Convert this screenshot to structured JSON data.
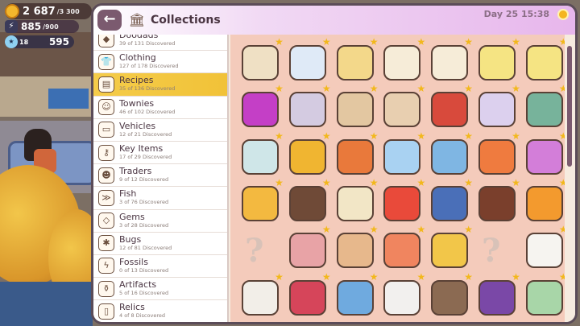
{
  "hud": {
    "coins": "2 687",
    "coins_max": "/3 300",
    "energy": "885",
    "energy_max": "/900",
    "level": "18",
    "points": "595"
  },
  "header": {
    "title": "Collections",
    "day": "Day 25",
    "time": "15:38"
  },
  "categories": [
    {
      "name": "Doodads",
      "sub": "39 of 131 Discovered",
      "icon": "doodads-icon",
      "glyph": "◆"
    },
    {
      "name": "Clothing",
      "sub": "127 of 178 Discovered",
      "icon": "shirt-icon",
      "glyph": "👕"
    },
    {
      "name": "Recipes",
      "sub": "35 of 136 Discovered",
      "icon": "recipes-icon",
      "glyph": "▤",
      "active": true
    },
    {
      "name": "Townies",
      "sub": "46 of 102 Discovered",
      "icon": "townies-icon",
      "glyph": "☺"
    },
    {
      "name": "Vehicles",
      "sub": "12 of 21 Discovered",
      "icon": "car-icon",
      "glyph": "▭"
    },
    {
      "name": "Key Items",
      "sub": "17 of 29 Discovered",
      "icon": "key-icon",
      "glyph": "⚷"
    },
    {
      "name": "Traders",
      "sub": "9 of 12 Discovered",
      "icon": "trader-icon",
      "glyph": "☻"
    },
    {
      "name": "Fish",
      "sub": "3 of 76 Discovered",
      "icon": "fish-icon",
      "glyph": "≫"
    },
    {
      "name": "Gems",
      "sub": "3 of 28 Discovered",
      "icon": "gem-icon",
      "glyph": "◇"
    },
    {
      "name": "Bugs",
      "sub": "12 of 81 Discovered",
      "icon": "bug-icon",
      "glyph": "✱"
    },
    {
      "name": "Fossils",
      "sub": "0 of 13 Discovered",
      "icon": "fossil-icon",
      "glyph": "ϟ"
    },
    {
      "name": "Artifacts",
      "sub": "5 of 16 Discovered",
      "icon": "artifact-icon",
      "glyph": "⚱"
    },
    {
      "name": "Relics",
      "sub": "4 of 8 Discovered",
      "icon": "relic-icon",
      "glyph": "▯"
    }
  ],
  "grid_items": [
    {
      "name": "bread-loaf-item",
      "color": "#efe0c4"
    },
    {
      "name": "milk-bottle-item",
      "color": "#dfeaf7"
    },
    {
      "name": "butter-blocks-item",
      "color": "#f3d88a"
    },
    {
      "name": "tofu-block-item",
      "color": "#f6ecd8"
    },
    {
      "name": "tofu-slab-item",
      "color": "#f6ecd8"
    },
    {
      "name": "cheese-wheel-item",
      "color": "#f5e483"
    },
    {
      "name": "cheese-round-item",
      "color": "#f5e483"
    },
    {
      "name": "purple-roll-item",
      "color": "#c43fc6"
    },
    {
      "name": "sausage-link-item",
      "color": "#d4cbe1"
    },
    {
      "name": "flour-sack-item",
      "color": "#e3c7a1"
    },
    {
      "name": "paper-bag-item",
      "color": "#e8cfb0"
    },
    {
      "name": "spice-sack-item",
      "color": "#d84a3c"
    },
    {
      "name": "crystal-bag-item",
      "color": "#dcd0ee"
    },
    {
      "name": "herb-crate-item",
      "color": "#77b39b"
    },
    {
      "name": "cookie-jar-item",
      "color": "#cfe6e8"
    },
    {
      "name": "honey-jar-item",
      "color": "#f0b531"
    },
    {
      "name": "hotdog-item",
      "color": "#e9793b"
    },
    {
      "name": "ice-block-item",
      "color": "#a9d2f2"
    },
    {
      "name": "potion-bottle-item",
      "color": "#7fb6e3"
    },
    {
      "name": "popsicle-item",
      "color": "#ef7b3f"
    },
    {
      "name": "cotton-candy-item",
      "color": "#d37ed9"
    },
    {
      "name": "fries-tray-item",
      "color": "#f3b940"
    },
    {
      "name": "soda-cup-item",
      "color": "#6f4a37"
    },
    {
      "name": "fried-egg-plate-item",
      "color": "#f2e6c6"
    },
    {
      "name": "fries-box-item",
      "color": "#e94a3a"
    },
    {
      "name": "blue-cake-item",
      "color": "#4a6fb8"
    },
    {
      "name": "chocolate-donut-item",
      "color": "#7a3f2c"
    },
    {
      "name": "orange-juice-item",
      "color": "#f39a2e"
    },
    {
      "name": "unknown-item",
      "unknown": true
    },
    {
      "name": "meat-skewer-item",
      "color": "#e8a3a6"
    },
    {
      "name": "veg-skewer-item",
      "color": "#e7b88c"
    },
    {
      "name": "sushi-plate-item",
      "color": "#f0855f"
    },
    {
      "name": "taco-item",
      "color": "#f2c649"
    },
    {
      "name": "unknown-item",
      "unknown": true
    },
    {
      "name": "milk-carton-item",
      "color": "#f6f4f0"
    },
    {
      "name": "cream-carton-item",
      "color": "#f2eee8"
    },
    {
      "name": "sausage-item",
      "color": "#d6455a"
    },
    {
      "name": "fabric-stack-item",
      "color": "#6faadf"
    },
    {
      "name": "googly-eyes-item",
      "color": "#f2f0ee"
    },
    {
      "name": "wood-crate-item",
      "color": "#8b6a52"
    },
    {
      "name": "grape-bag-item",
      "color": "#7a48a7"
    },
    {
      "name": "cash-bundle-item",
      "color": "#a8d6a8"
    }
  ]
}
